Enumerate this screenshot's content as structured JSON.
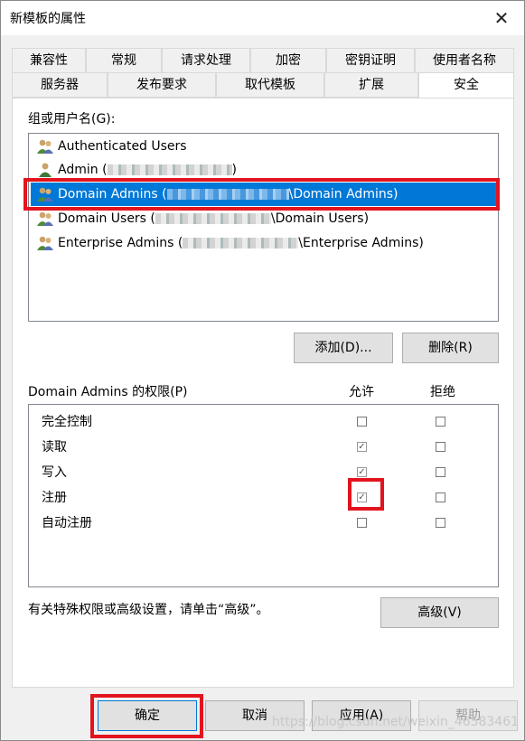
{
  "window": {
    "title": "新模板的属性",
    "close_glyph": "✕"
  },
  "tabs": {
    "row1": [
      "兼容性",
      "常规",
      "请求处理",
      "加密",
      "密钥证明",
      "使用者名称"
    ],
    "row2": [
      "服务器",
      "发布要求",
      "取代模板",
      "扩展",
      "安全"
    ],
    "active": "安全"
  },
  "security": {
    "groups_label": "组或用户名(G):",
    "users": [
      {
        "name": "Authenticated Users",
        "suffix": "",
        "icon": "group-icon"
      },
      {
        "name": "Admin (",
        "suffix": ")",
        "icon": "user-icon"
      },
      {
        "name": "Domain Admins (",
        "suffix": "\\Domain Admins)",
        "icon": "group-icon"
      },
      {
        "name": "Domain Users (",
        "suffix": "\\Domain Users)",
        "icon": "group-icon"
      },
      {
        "name": "Enterprise Admins (",
        "suffix": "\\Enterprise Admins)",
        "icon": "group-icon"
      }
    ],
    "selected_user": "Domain Admins",
    "add_button": "添加(D)...",
    "remove_button": "删除(R)",
    "permissions_label": "Domain Admins 的权限(P)",
    "allow_header": "允许",
    "deny_header": "拒绝",
    "permissions": [
      {
        "name": "完全控制",
        "allow": false,
        "deny": false
      },
      {
        "name": "读取",
        "allow": true,
        "deny": false
      },
      {
        "name": "写入",
        "allow": true,
        "deny": false
      },
      {
        "name": "注册",
        "allow": true,
        "deny": false
      },
      {
        "name": "自动注册",
        "allow": false,
        "deny": false
      }
    ],
    "advanced_hint": "有关特殊权限或高级设置，请单击“高级”。",
    "advanced_button": "高级(V)"
  },
  "footer": {
    "ok": "确定",
    "cancel": "取消",
    "apply": "应用(A)",
    "help": "帮助"
  },
  "watermark": "https://blog.csdn.net/weixin_46583461",
  "colors": {
    "selection": "#0078d7",
    "highlight": "#e2141e"
  }
}
